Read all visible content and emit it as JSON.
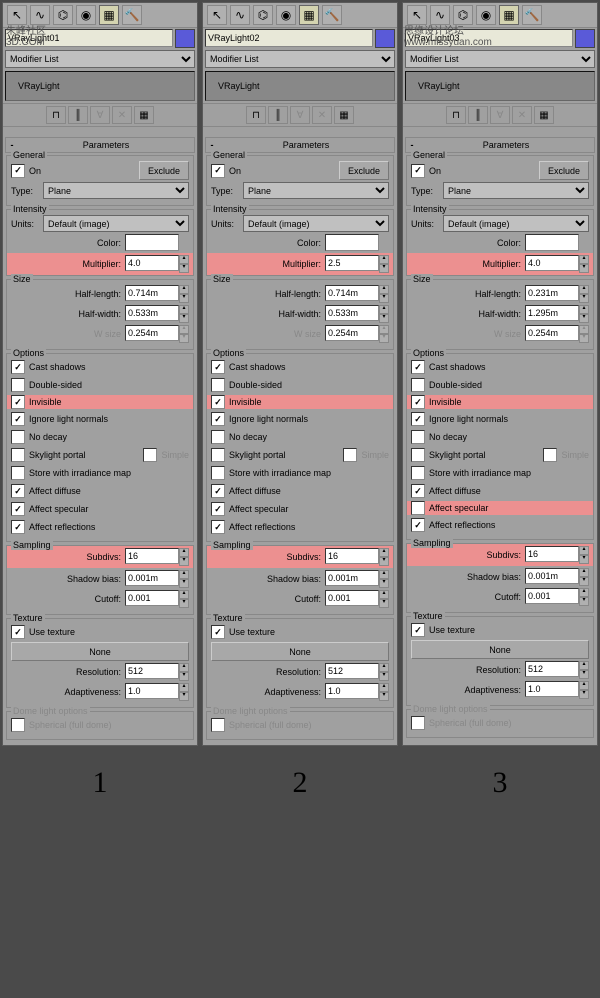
{
  "panels": [
    {
      "name": "VRayLight01",
      "color": "#5a5ad8",
      "modifierList": "Modifier List",
      "stack": "VRayLight",
      "watermark": "朱峰社区",
      "watermark2": "3D.COM",
      "params": {
        "title": "Parameters",
        "general": {
          "title": "General",
          "on": true,
          "onLabel": "On",
          "exclude": "Exclude",
          "typeLabel": "Type:",
          "type": "Plane"
        },
        "intensity": {
          "title": "Intensity",
          "unitsLabel": "Units:",
          "units": "Default (image)",
          "colorLabel": "Color:",
          "multLabel": "Multiplier:",
          "mult": "4.0",
          "multHL": true
        },
        "size": {
          "title": "Size",
          "hlLabel": "Half-length:",
          "hl": "0.714m",
          "hwLabel": "Half-width:",
          "hw": "0.533m",
          "wsLabel": "W size",
          "ws": "0.254m"
        },
        "options": {
          "title": "Options",
          "cast": {
            "l": "Cast shadows",
            "v": true,
            "hl": false
          },
          "dbl": {
            "l": "Double-sided",
            "v": false,
            "hl": false
          },
          "inv": {
            "l": "Invisible",
            "v": true,
            "hl": true
          },
          "ign": {
            "l": "Ignore light normals",
            "v": true,
            "hl": false
          },
          "nod": {
            "l": "No decay",
            "v": false,
            "hl": false
          },
          "sky": {
            "l": "Skylight portal",
            "v": false,
            "hl": false
          },
          "simple": "Simple",
          "store": {
            "l": "Store with irradiance map",
            "v": false,
            "hl": false
          },
          "adf": {
            "l": "Affect diffuse",
            "v": true,
            "hl": false
          },
          "asp": {
            "l": "Affect specular",
            "v": true,
            "hl": false
          },
          "arf": {
            "l": "Affect reflections",
            "v": true,
            "hl": false
          }
        },
        "sampling": {
          "title": "Sampling",
          "subLabel": "Subdivs:",
          "sub": "16",
          "subHL": true,
          "sbLabel": "Shadow bias:",
          "sb": "0.001m",
          "coLabel": "Cutoff:",
          "co": "0.001"
        },
        "texture": {
          "title": "Texture",
          "use": {
            "l": "Use texture",
            "v": true
          },
          "none": "None",
          "resLabel": "Resolution:",
          "res": "512",
          "adLabel": "Adaptiveness:",
          "ad": "1.0"
        },
        "dome": {
          "title": "Dome light options",
          "sph": "Spherical (full dome)"
        }
      }
    },
    {
      "name": "VRayLight02",
      "color": "#5a5ad8",
      "modifierList": "Modifier List",
      "stack": "VRayLight",
      "watermark": "",
      "watermark2": "",
      "params": {
        "title": "Parameters",
        "general": {
          "title": "General",
          "on": true,
          "onLabel": "On",
          "exclude": "Exclude",
          "typeLabel": "Type:",
          "type": "Plane"
        },
        "intensity": {
          "title": "Intensity",
          "unitsLabel": "Units:",
          "units": "Default (image)",
          "colorLabel": "Color:",
          "multLabel": "Multiplier:",
          "mult": "2.5",
          "multHL": true
        },
        "size": {
          "title": "Size",
          "hlLabel": "Half-length:",
          "hl": "0.714m",
          "hwLabel": "Half-width:",
          "hw": "0.533m",
          "wsLabel": "W size",
          "ws": "0.254m"
        },
        "options": {
          "title": "Options",
          "cast": {
            "l": "Cast shadows",
            "v": true,
            "hl": false
          },
          "dbl": {
            "l": "Double-sided",
            "v": false,
            "hl": false
          },
          "inv": {
            "l": "Invisible",
            "v": true,
            "hl": true
          },
          "ign": {
            "l": "Ignore light normals",
            "v": true,
            "hl": false
          },
          "nod": {
            "l": "No decay",
            "v": false,
            "hl": false
          },
          "sky": {
            "l": "Skylight portal",
            "v": false,
            "hl": false
          },
          "simple": "Simple",
          "store": {
            "l": "Store with irradiance map",
            "v": false,
            "hl": false
          },
          "adf": {
            "l": "Affect diffuse",
            "v": true,
            "hl": false
          },
          "asp": {
            "l": "Affect specular",
            "v": true,
            "hl": false
          },
          "arf": {
            "l": "Affect reflections",
            "v": true,
            "hl": false
          }
        },
        "sampling": {
          "title": "Sampling",
          "subLabel": "Subdivs:",
          "sub": "16",
          "subHL": true,
          "sbLabel": "Shadow bias:",
          "sb": "0.001m",
          "coLabel": "Cutoff:",
          "co": "0.001"
        },
        "texture": {
          "title": "Texture",
          "use": {
            "l": "Use texture",
            "v": true
          },
          "none": "None",
          "resLabel": "Resolution:",
          "res": "512",
          "adLabel": "Adaptiveness:",
          "ad": "1.0"
        },
        "dome": {
          "title": "Dome light options",
          "sph": "Spherical (full dome)"
        }
      }
    },
    {
      "name": "VRayLight03",
      "color": "#5a5ad8",
      "modifierList": "Modifier List",
      "stack": "VRayLight",
      "watermark": "思缘设计论坛",
      "watermark2": "www.missyuan.com",
      "params": {
        "title": "Parameters",
        "general": {
          "title": "General",
          "on": true,
          "onLabel": "On",
          "exclude": "Exclude",
          "typeLabel": "Type:",
          "type": "Plane"
        },
        "intensity": {
          "title": "Intensity",
          "unitsLabel": "Units:",
          "units": "Default (image)",
          "colorLabel": "Color:",
          "multLabel": "Multiplier:",
          "mult": "4.0",
          "multHL": true
        },
        "size": {
          "title": "Size",
          "hlLabel": "Half-length:",
          "hl": "0.231m",
          "hwLabel": "Half-width:",
          "hw": "1.295m",
          "wsLabel": "W size",
          "ws": "0.254m"
        },
        "options": {
          "title": "Options",
          "cast": {
            "l": "Cast shadows",
            "v": true,
            "hl": false
          },
          "dbl": {
            "l": "Double-sided",
            "v": false,
            "hl": false
          },
          "inv": {
            "l": "Invisible",
            "v": true,
            "hl": true
          },
          "ign": {
            "l": "Ignore light normals",
            "v": true,
            "hl": false
          },
          "nod": {
            "l": "No decay",
            "v": false,
            "hl": false
          },
          "sky": {
            "l": "Skylight portal",
            "v": false,
            "hl": false
          },
          "simple": "Simple",
          "store": {
            "l": "Store with irradiance map",
            "v": false,
            "hl": false
          },
          "adf": {
            "l": "Affect diffuse",
            "v": true,
            "hl": false
          },
          "asp": {
            "l": "Affect specular",
            "v": false,
            "hl": true
          },
          "arf": {
            "l": "Affect reflections",
            "v": true,
            "hl": false
          }
        },
        "sampling": {
          "title": "Sampling",
          "subLabel": "Subdivs:",
          "sub": "16",
          "subHL": true,
          "sbLabel": "Shadow bias:",
          "sb": "0.001m",
          "coLabel": "Cutoff:",
          "co": "0.001"
        },
        "texture": {
          "title": "Texture",
          "use": {
            "l": "Use texture",
            "v": true
          },
          "none": "None",
          "resLabel": "Resolution:",
          "res": "512",
          "adLabel": "Adaptiveness:",
          "ad": "1.0"
        },
        "dome": {
          "title": "Dome light options",
          "sph": "Spherical (full dome)"
        }
      }
    }
  ],
  "footer": [
    "1",
    "2",
    "3"
  ]
}
